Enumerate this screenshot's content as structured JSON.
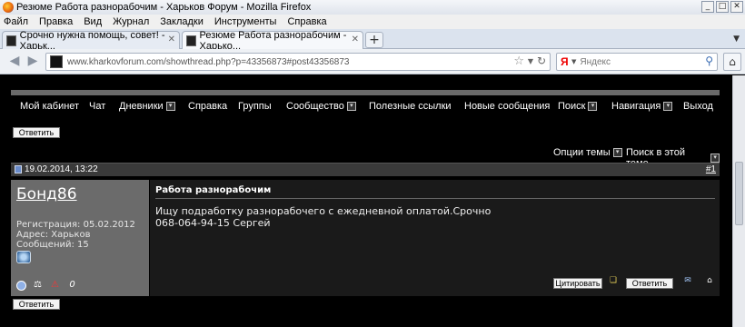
{
  "window": {
    "title": "Резюме Работа разнорабочим - Харьков Форум - Mozilla Firefox",
    "controls": [
      "_",
      "□",
      "✕"
    ]
  },
  "menu": [
    "Файл",
    "Правка",
    "Вид",
    "Журнал",
    "Закладки",
    "Инструменты",
    "Справка"
  ],
  "tabs": [
    {
      "label": "Срочно нужна помощь, совет! - Харьк...",
      "close": "✕"
    },
    {
      "label": "Резюме Работа разнорабочим - Харько...",
      "close": "✕"
    }
  ],
  "newtab": "+",
  "browser": {
    "url": "www.kharkovforum.com/showthread.php?p=43356873#post43356873",
    "search_placeholder": "Яндекс",
    "search_engine_letter": "Я"
  },
  "forum": {
    "nav": [
      "Мой кабинет",
      "Чат",
      "Дневники",
      "Справка",
      "Группы",
      "Сообщество",
      "Полезные ссылки",
      "Новые сообщения",
      "Поиск",
      "Навигация",
      "Выход"
    ],
    "reply_label": "Ответить",
    "thread_options": "Опции темы",
    "search_thread": "Поиск в этой теме",
    "post": {
      "date": "19.02.2014, 13:22",
      "number": "#1",
      "username": "Бонд86",
      "registration": "Регистрация: 05.02.2012",
      "address": "Адрес: Харьков",
      "messages": "Сообщений: 15",
      "reputation": "0",
      "title": "Работа разнорабочим",
      "text_line1": "Ищу подработку разнорабочего с ежедневной оплатой.Срочно",
      "text_line2": "068-064-94-15 Сергей",
      "quote_label": "Цитировать",
      "reply_label": "Ответить"
    }
  }
}
